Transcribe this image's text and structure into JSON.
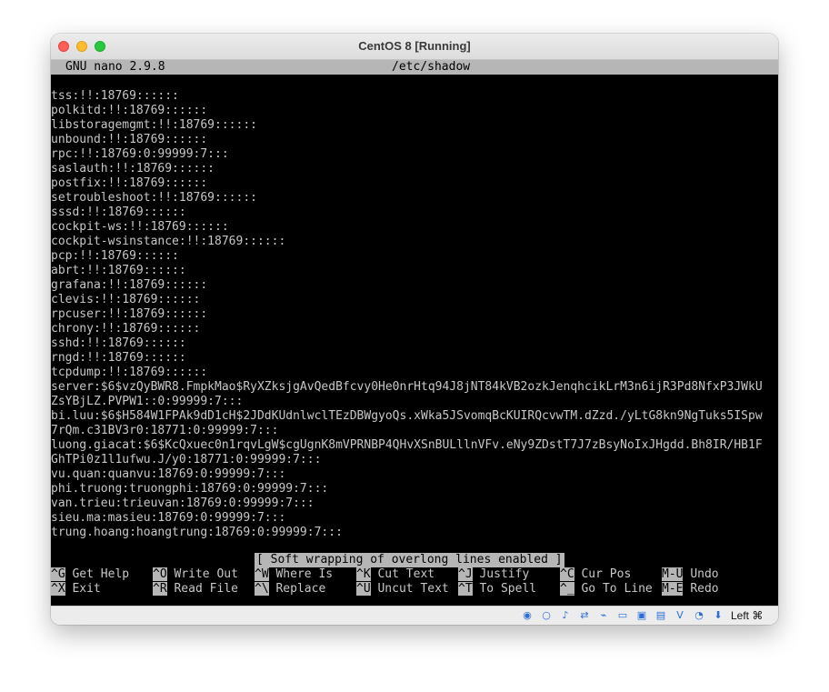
{
  "window": {
    "title": "CentOS 8 [Running]"
  },
  "nano": {
    "version": "GNU nano 2.9.8",
    "filename": "/etc/shadow",
    "lines": [
      "tss:!!:18769::::::",
      "polkitd:!!:18769::::::",
      "libstoragemgmt:!!:18769::::::",
      "unbound:!!:18769::::::",
      "rpc:!!:18769:0:99999:7:::",
      "saslauth:!!:18769::::::",
      "postfix:!!:18769::::::",
      "setroubleshoot:!!:18769::::::",
      "sssd:!!:18769::::::",
      "cockpit-ws:!!:18769::::::",
      "cockpit-wsinstance:!!:18769::::::",
      "pcp:!!:18769::::::",
      "abrt:!!:18769::::::",
      "grafana:!!:18769::::::",
      "clevis:!!:18769::::::",
      "rpcuser:!!:18769::::::",
      "chrony:!!:18769::::::",
      "sshd:!!:18769::::::",
      "rngd:!!:18769::::::",
      "tcpdump:!!:18769::::::",
      "server:$6$vzQyBWR8.FmpkMao$RyXZksjgAvQedBfcvy0He0nrHtq94J8jNT84kVB2ozkJenqhcikLrM3n6ijR3Pd8NfxP3JWkU",
      "ZsYBjLZ.PVPW1::0:99999:7:::",
      "bi.luu:$6$H584W1FPAk9dD1cH$2JDdKUdnlwclTEzDBWgyoQs.xWka5JSvomqBcKUIRQcvwTM.dZzd./yLtG8kn9NgTuks5ISpw",
      "7rQm.c31BV3r0:18771:0:99999:7:::",
      "luong.giacat:$6$KcQxuec0n1rqvLgW$cgUgnK8mVPRNBP4QHvXSnBULllnVFv.eNy9ZDstT7J7zBsyNoIxJHgdd.Bh8IR/HB1F",
      "GhTPi0z1l1ufwu.J/y0:18771:0:99999:7:::",
      "vu.quan:quanvu:18769:0:99999:7:::",
      "phi.truong:truongphi:18769:0:99999:7:::",
      "van.trieu:trieuvan:18769:0:99999:7:::",
      "sieu.ma:masieu:18769:0:99999:7:::",
      "trung.hoang:hoangtrung:18769:0:99999:7:::"
    ],
    "status_message": "[ Soft wrapping of overlong lines enabled ]",
    "shortcuts": [
      {
        "key": "^G",
        "label": "Get Help"
      },
      {
        "key": "^O",
        "label": "Write Out"
      },
      {
        "key": "^W",
        "label": "Where Is"
      },
      {
        "key": "^K",
        "label": "Cut Text"
      },
      {
        "key": "^J",
        "label": "Justify"
      },
      {
        "key": "^C",
        "label": "Cur Pos"
      },
      {
        "key": "M-U",
        "label": "Undo"
      },
      {
        "key": "^X",
        "label": "Exit"
      },
      {
        "key": "^R",
        "label": "Read File"
      },
      {
        "key": "^\\",
        "label": "Replace"
      },
      {
        "key": "^U",
        "label": "Uncut Text"
      },
      {
        "key": "^T",
        "label": "To Spell"
      },
      {
        "key": "^_",
        "label": "Go To Line"
      },
      {
        "key": "M-E",
        "label": "Redo"
      }
    ]
  },
  "statusbar": {
    "host_key": "Left ⌘",
    "icons": [
      "optical-drive-icon",
      "floppy-icon",
      "audio-icon",
      "network-icon",
      "usb-icon",
      "shared-folders-icon",
      "display-icon",
      "recording-icon",
      "virtualization-icon",
      "cpu-icon",
      "mouse-integration-icon"
    ]
  }
}
